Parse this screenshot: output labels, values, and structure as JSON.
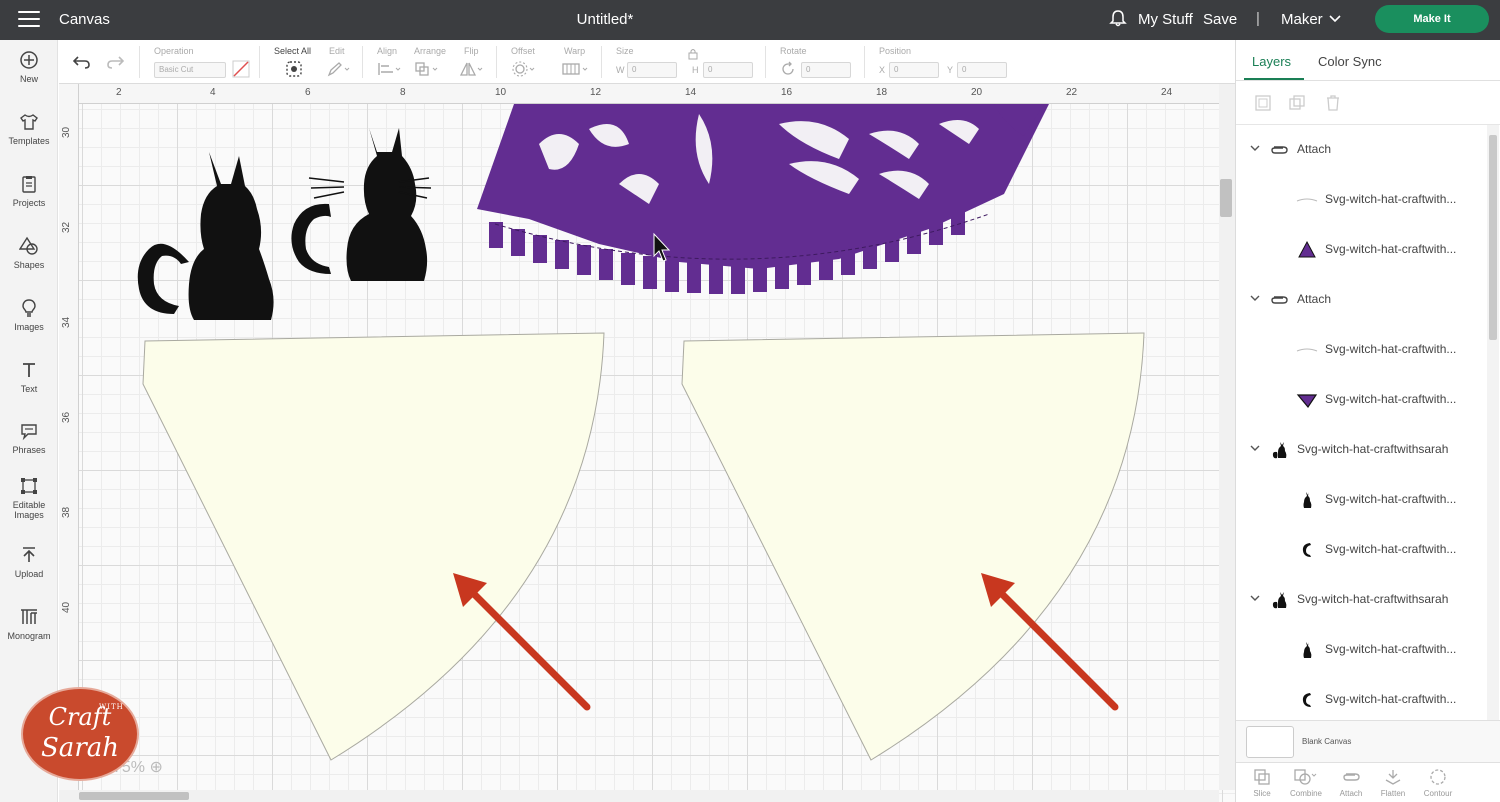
{
  "header": {
    "app_title": "Canvas",
    "doc_title": "Untitled*",
    "my_stuff": "My Stuff",
    "save": "Save",
    "separator": "|",
    "machine": "Maker",
    "make_it": "Make It",
    "make_it_color": "#1a8f5e"
  },
  "leftnav": {
    "items": [
      {
        "label": "New",
        "icon": "plus-circle-icon"
      },
      {
        "label": "Templates",
        "icon": "tshirt-icon"
      },
      {
        "label": "Projects",
        "icon": "clipboard-icon"
      },
      {
        "label": "Shapes",
        "icon": "shapes-icon"
      },
      {
        "label": "Images",
        "icon": "lightbulb-icon"
      },
      {
        "label": "Text",
        "icon": "text-icon"
      },
      {
        "label": "Phrases",
        "icon": "speech-bubble-icon"
      },
      {
        "label": "Editable",
        "label2": "Images",
        "icon": "editable-images-icon"
      },
      {
        "label": "Upload",
        "icon": "upload-icon"
      },
      {
        "label": "Monogram",
        "icon": "monogram-icon"
      }
    ]
  },
  "toolbar": {
    "operation": "Operation",
    "operation_value": "Basic Cut",
    "select_all": "Select All",
    "edit": "Edit",
    "align": "Align",
    "arrange": "Arrange",
    "flip": "Flip",
    "offset": "Offset",
    "warp": "Warp",
    "size": "Size",
    "w": "W",
    "h": "H",
    "w_value": "0",
    "h_value": "0",
    "rotate": "Rotate",
    "rotate_value": "0",
    "position": "Position",
    "x": "X",
    "y": "Y",
    "x_value": "0",
    "y_value": "0"
  },
  "rulers": {
    "top": [
      "2",
      "4",
      "6",
      "8",
      "10",
      "12",
      "14",
      "16",
      "18",
      "20",
      "22",
      "24"
    ],
    "left": [
      "30",
      "32",
      "34",
      "36",
      "38",
      "40"
    ]
  },
  "canvas": {
    "zoom": "75%",
    "hat_color": "#622d91",
    "cone_color": "#fcfdea",
    "arrow_color": "#c8371f"
  },
  "badge": {
    "line1": "Craft",
    "with": "WITH",
    "line2": "Sarah"
  },
  "panel": {
    "tabs": [
      "Layers",
      "Color Sync"
    ],
    "layers": [
      {
        "type": "group",
        "icon": "attach-icon",
        "label": "Attach"
      },
      {
        "type": "child",
        "icon": "line-thumb-icon",
        "label": "Svg-witch-hat-craftwith..."
      },
      {
        "type": "child",
        "icon": "purple-hat-thumb-icon",
        "label": "Svg-witch-hat-craftwith..."
      },
      {
        "type": "group",
        "icon": "attach-icon",
        "label": "Attach"
      },
      {
        "type": "child",
        "icon": "line-thumb-icon",
        "label": "Svg-witch-hat-craftwith..."
      },
      {
        "type": "child",
        "icon": "purple-brim-thumb-icon",
        "label": "Svg-witch-hat-craftwith..."
      },
      {
        "type": "group",
        "icon": "cat-group-thumb-icon",
        "label": "Svg-witch-hat-craftwithsarah"
      },
      {
        "type": "child",
        "icon": "cat-thumb-icon",
        "label": "Svg-witch-hat-craftwith..."
      },
      {
        "type": "child",
        "icon": "tail-thumb-icon",
        "label": "Svg-witch-hat-craftwith..."
      },
      {
        "type": "group",
        "icon": "cat-group-thumb-icon",
        "label": "Svg-witch-hat-craftwithsarah"
      },
      {
        "type": "child",
        "icon": "cat-thumb-icon",
        "label": "Svg-witch-hat-craftwith..."
      },
      {
        "type": "child",
        "icon": "tail-thumb-icon",
        "label": "Svg-witch-hat-craftwith..."
      }
    ],
    "blank_canvas": "Blank Canvas",
    "bottom_actions": [
      "Slice",
      "Combine",
      "Attach",
      "Flatten",
      "Contour"
    ]
  }
}
